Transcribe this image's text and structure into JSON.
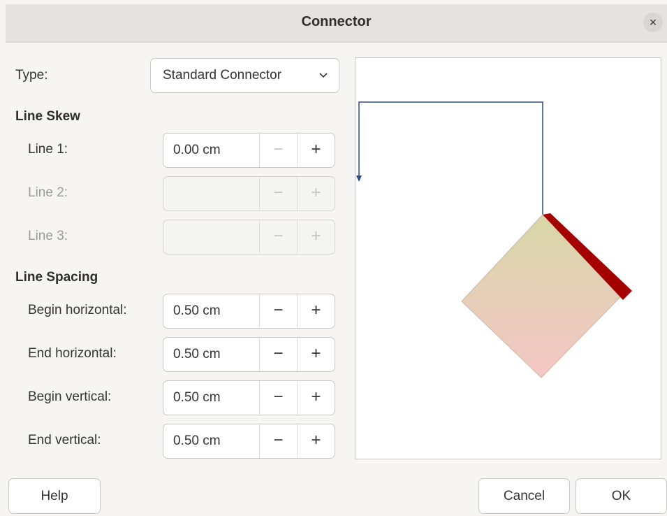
{
  "dialog": {
    "title": "Connector",
    "close_glyph": "×"
  },
  "type_row": {
    "label": "Type:",
    "value": "Standard Connector"
  },
  "line_skew": {
    "heading": "Line Skew",
    "rows": [
      {
        "label": "Line 1:",
        "value": "0.00 cm",
        "enabled": true
      },
      {
        "label": "Line 2:",
        "value": "",
        "enabled": false
      },
      {
        "label": "Line 3:",
        "value": "",
        "enabled": false
      }
    ]
  },
  "line_spacing": {
    "heading": "Line Spacing",
    "rows": [
      {
        "label": "Begin horizontal:",
        "value": "0.50 cm"
      },
      {
        "label": "End horizontal:",
        "value": "0.50 cm"
      },
      {
        "label": "Begin vertical:",
        "value": "0.50 cm"
      },
      {
        "label": "End vertical:",
        "value": "0.50 cm"
      }
    ]
  },
  "spin_glyphs": {
    "minus": "−",
    "plus": "+"
  },
  "buttons": {
    "help": "Help",
    "cancel": "Cancel",
    "ok": "OK"
  },
  "colors": {
    "connector_line": "#2b4a8a",
    "shape_border": "#a00000",
    "shape_fill_top": "#d7d7a8",
    "shape_fill_bottom": "#f5c6c6"
  },
  "icons": {
    "close": "close-icon",
    "dropdown": "chevron-down-icon"
  }
}
